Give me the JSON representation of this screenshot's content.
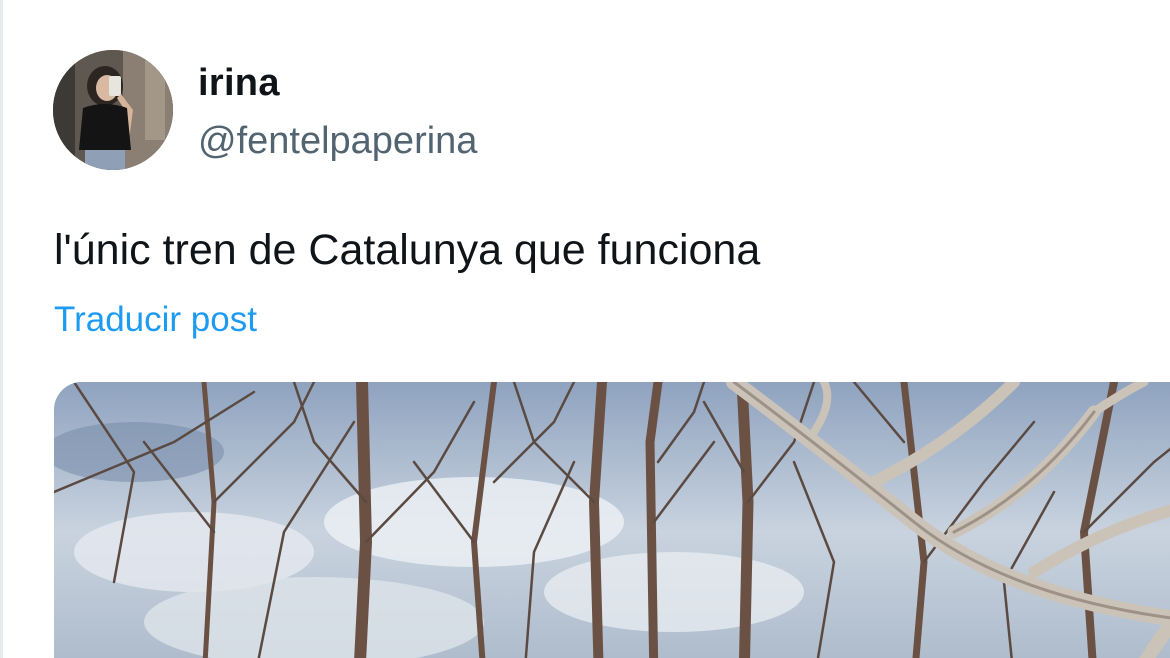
{
  "tweet": {
    "author": {
      "display_name": "irina",
      "handle": "@fentelpaperina",
      "avatar_icon": "profile-photo"
    },
    "text": "l'únic tren de Catalunya que funciona",
    "translate_label": "Traducir post",
    "media_icon": "photo-bare-trees"
  },
  "colors": {
    "text_primary": "#0f1419",
    "text_secondary": "#536471",
    "link": "#1d9bf0",
    "background": "#ffffff"
  }
}
